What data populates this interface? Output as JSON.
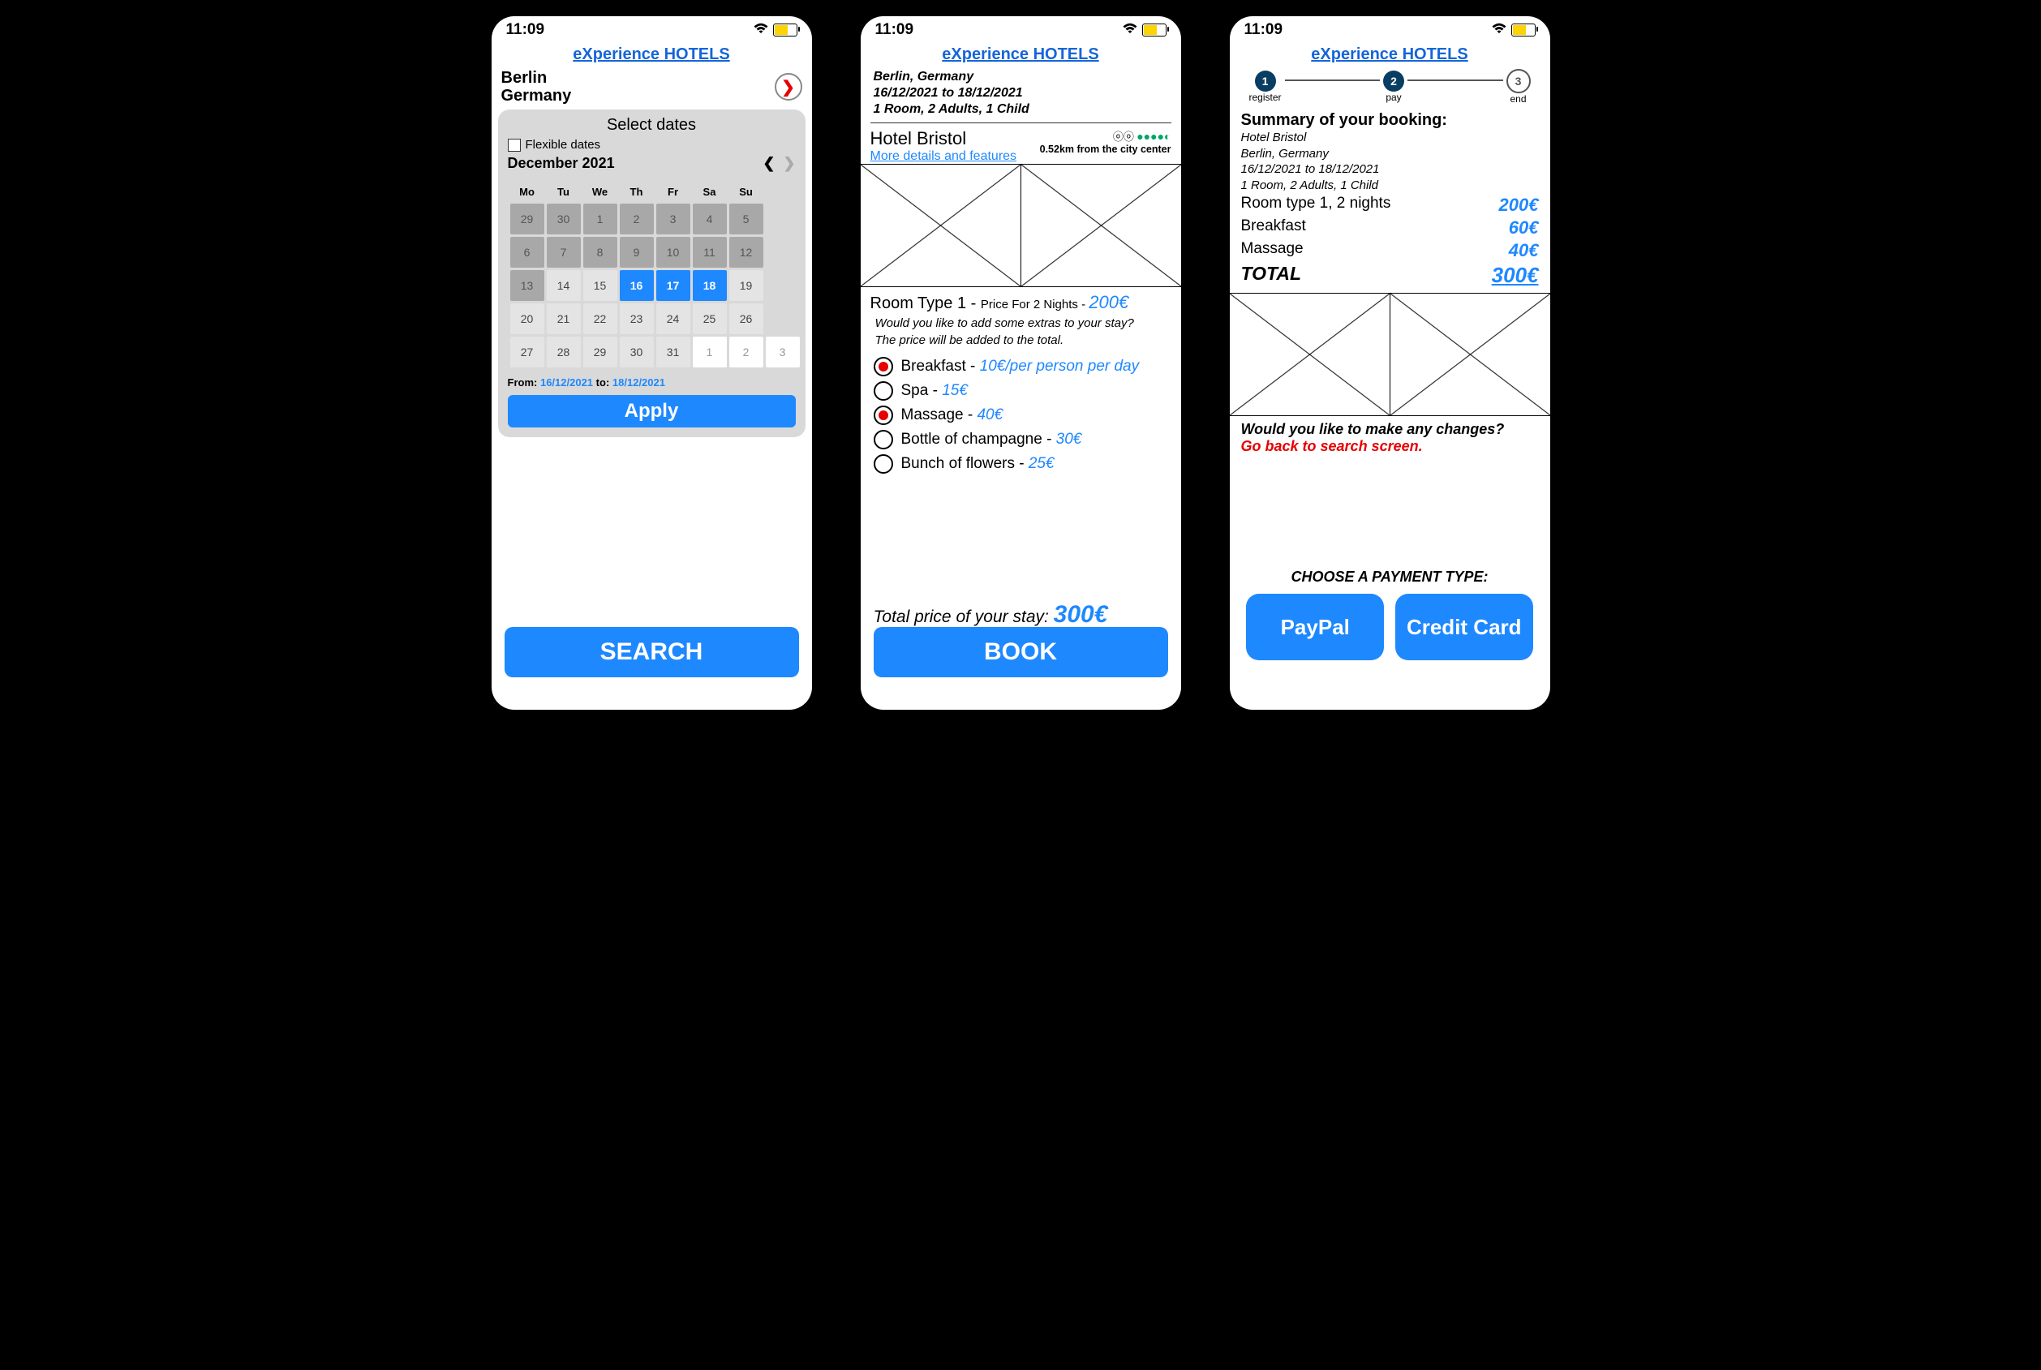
{
  "status": {
    "time": "11:09"
  },
  "app": {
    "title": "eXperience HOTELS"
  },
  "screen1": {
    "city": "Berlin",
    "country": "Germany",
    "datepicker": {
      "title": "Select dates",
      "flexible": "Flexible dates",
      "month": "December 2021",
      "weekdays": [
        "Mo",
        "Tu",
        "We",
        "Th",
        "Fr",
        "Sa",
        "Su"
      ],
      "prevDays": [
        "29",
        "30",
        "1",
        "2",
        "3",
        "4",
        "5",
        "6",
        "7",
        "8",
        "9",
        "10",
        "11",
        "12",
        "13"
      ],
      "days": [
        "14",
        "15",
        "16",
        "17",
        "18",
        "19",
        "20",
        "21",
        "22",
        "23",
        "24",
        "25",
        "26",
        "27",
        "28",
        "29",
        "30",
        "31"
      ],
      "nextDays": [
        "1",
        "2",
        "3"
      ],
      "fromLabel": "From:",
      "fromDate": "16/12/2021",
      "toLabel": "to:",
      "toDate": "18/12/2021",
      "apply": "Apply"
    },
    "search": "SEARCH"
  },
  "screen2": {
    "info1": "Berlin, Germany",
    "info2": "16/12/2021 to 18/12/2021",
    "info3": "1 Room, 2 Adults, 1 Child",
    "hotel": "Hotel Bristol",
    "details": "More details and features",
    "distance": "0.52km from the city center",
    "roomType": "Room Type 1 - ",
    "priceFor": " Price For 2 Nights  - ",
    "roomPrice": " 200€",
    "extrasQ1": "Would you like to add some extras to your stay?",
    "extrasQ2": "The price will be added to the total.",
    "extras": [
      {
        "name": "Breakfast - ",
        "price": "10€/per person per day",
        "sel": true
      },
      {
        "name": "Spa - ",
        "price": "15€",
        "sel": false
      },
      {
        "name": "Massage - ",
        "price": "40€",
        "sel": true
      },
      {
        "name": "Bottle of champagne - ",
        "price": "30€",
        "sel": false
      },
      {
        "name": "Bunch of flowers - ",
        "price": "25€",
        "sel": false
      }
    ],
    "totalLabel": "Total price of your stay: ",
    "totalVal": "300€",
    "book": "BOOK"
  },
  "screen3": {
    "steps": [
      {
        "n": "1",
        "label": "register"
      },
      {
        "n": "2",
        "label": "pay"
      },
      {
        "n": "3",
        "label": "end"
      }
    ],
    "summaryTitle": "Summary of your booking:",
    "info1": "Hotel Bristol",
    "info2": "Berlin, Germany",
    "info3": "16/12/2021 to 18/12/2021",
    "info4": "1 Room, 2 Adults, 1 Child",
    "lines": [
      {
        "label": "Room type 1, 2 nights",
        "val": "200€"
      },
      {
        "label": "Breakfast",
        "val": "60€"
      },
      {
        "label": "Massage",
        "val": "40€"
      }
    ],
    "totalLabel": "TOTAL",
    "totalVal": "300€",
    "changesQ": "Would you like to make any changes?",
    "goback": "Go back to search screen.",
    "payTitle": "CHOOSE A PAYMENT TYPE:",
    "paypal": "PayPal",
    "credit": "Credit Card"
  }
}
